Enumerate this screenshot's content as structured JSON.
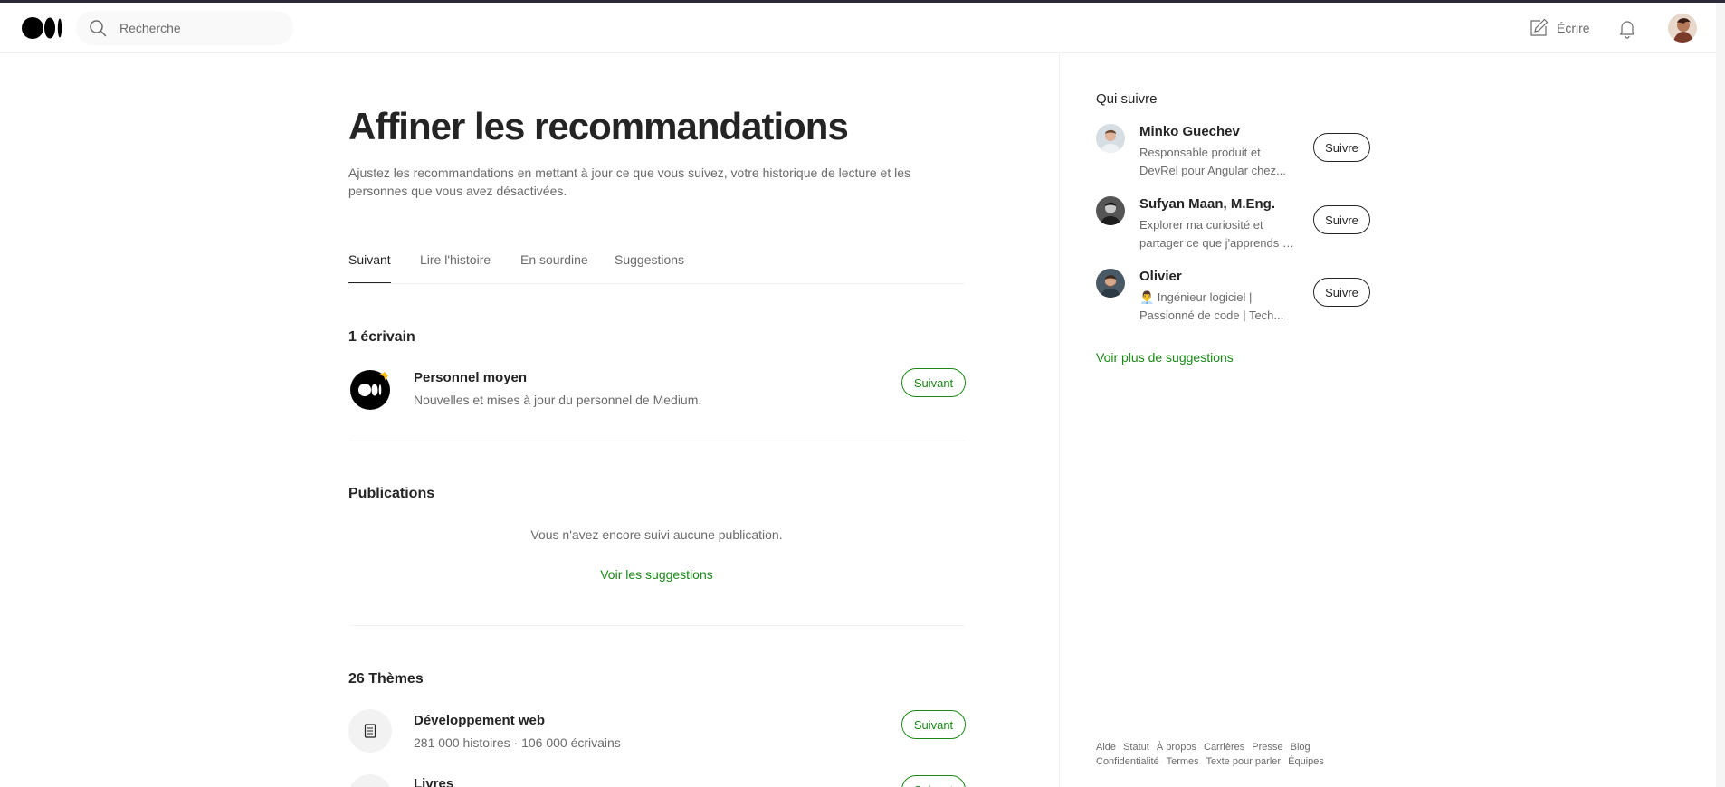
{
  "header": {
    "search_placeholder": "Recherche",
    "write_label": "Écrire"
  },
  "main": {
    "title": "Affiner les recommandations",
    "description": "Ajustez les recommandations en mettant à jour ce que vous suivez, votre historique de lecture et les personnes que vous avez désactivées.",
    "tabs": [
      {
        "label": "Suivant",
        "active": true
      },
      {
        "label": "Lire l'histoire",
        "active": false
      },
      {
        "label": "En sourdine",
        "active": false
      },
      {
        "label": "Suggestions",
        "active": false
      }
    ],
    "writers": {
      "title": "1 écrivain",
      "items": [
        {
          "name": "Personnel moyen",
          "description": "Nouvelles et mises à jour du personnel de Medium.",
          "button": "Suivant"
        }
      ]
    },
    "publications": {
      "title": "Publications",
      "empty_text": "Vous n'avez encore suivi aucune publication.",
      "link": "Voir les suggestions"
    },
    "themes": {
      "title": "26 Thèmes",
      "items": [
        {
          "name": "Développement web",
          "stats": "281 000 histoires · 106 000 écrivains",
          "button": "Suivant"
        },
        {
          "name": "Livres",
          "stats": "",
          "button": "Suivant"
        }
      ]
    }
  },
  "sidebar": {
    "title": "Qui suivre",
    "people": [
      {
        "name": "Minko Guechev",
        "bio_line1": "Responsable produit et",
        "bio_line2": "DevRel pour Angular chez...",
        "button": "Suivre"
      },
      {
        "name": "Sufyan Maan, M.Eng.",
        "bio_line1": "Explorer ma curiosité et",
        "bio_line2": "partager ce que j'apprends e...",
        "button": "Suivre"
      },
      {
        "name": "Olivier",
        "bio_line1": "👨‍💼 Ingénieur logiciel |",
        "bio_line2": "Passionné de code | Tech...",
        "button": "Suivre"
      }
    ],
    "more_link": "Voir plus de suggestions"
  },
  "footer": {
    "links": [
      "Aide",
      "Statut",
      "À propos",
      "Carrières",
      "Presse",
      "Blog",
      "Confidentialité",
      "Termes",
      "Texte pour parler",
      "Équipes"
    ]
  },
  "colors": {
    "accent_green": "#1a8917",
    "text": "#242424",
    "muted": "#6b6b6b"
  }
}
